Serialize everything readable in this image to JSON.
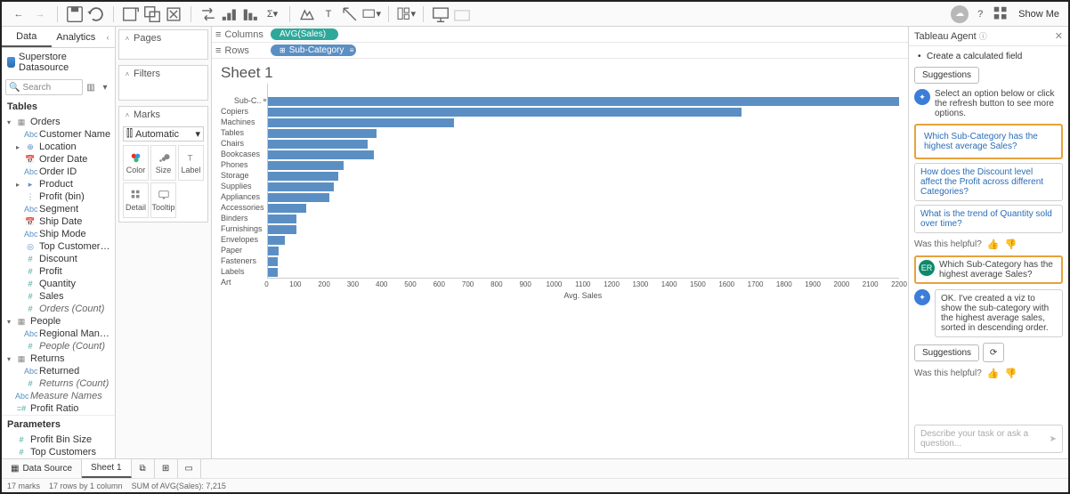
{
  "toolbar": {
    "show_me": "Show Me"
  },
  "tabs": {
    "data": "Data",
    "analytics": "Analytics"
  },
  "datasource": "Superstore Datasource",
  "search": {
    "placeholder": "Search"
  },
  "tables_header": "Tables",
  "parameters_header": "Parameters",
  "schema": {
    "orders": {
      "name": "Orders",
      "fields": [
        {
          "label": "Customer Name",
          "icon": "Abc",
          "cls": "dim-icon"
        },
        {
          "label": "Location",
          "icon": "⊕",
          "cls": "dim-icon",
          "caret": "▸"
        },
        {
          "label": "Order Date",
          "icon": "📅",
          "cls": "dim-icon"
        },
        {
          "label": "Order ID",
          "icon": "Abc",
          "cls": "dim-icon"
        },
        {
          "label": "Product",
          "icon": "▸",
          "cls": "dim-icon",
          "caret": "▸"
        },
        {
          "label": "Profit (bin)",
          "icon": "⋮",
          "cls": "dim-icon"
        },
        {
          "label": "Segment",
          "icon": "Abc",
          "cls": "dim-icon"
        },
        {
          "label": "Ship Date",
          "icon": "📅",
          "cls": "dim-icon"
        },
        {
          "label": "Ship Mode",
          "icon": "Abc",
          "cls": "dim-icon"
        },
        {
          "label": "Top Customers by P...",
          "icon": "◎",
          "cls": "dim-icon"
        },
        {
          "label": "Discount",
          "icon": "#",
          "cls": "meas-icon"
        },
        {
          "label": "Profit",
          "icon": "#",
          "cls": "meas-icon"
        },
        {
          "label": "Quantity",
          "icon": "#",
          "cls": "meas-icon"
        },
        {
          "label": "Sales",
          "icon": "#",
          "cls": "meas-icon"
        },
        {
          "label": "Orders (Count)",
          "icon": "#",
          "cls": "meas-icon",
          "italic": true
        }
      ]
    },
    "people": {
      "name": "People",
      "fields": [
        {
          "label": "Regional Manager",
          "icon": "Abc",
          "cls": "dim-icon"
        },
        {
          "label": "People (Count)",
          "icon": "#",
          "cls": "meas-icon",
          "italic": true
        }
      ]
    },
    "returns": {
      "name": "Returns",
      "fields": [
        {
          "label": "Returned",
          "icon": "Abc",
          "cls": "dim-icon"
        },
        {
          "label": "Returns (Count)",
          "icon": "#",
          "cls": "meas-icon",
          "italic": true
        }
      ]
    },
    "extra": [
      {
        "label": "Measure Names",
        "icon": "Abc",
        "cls": "dim-icon",
        "italic": true
      },
      {
        "label": "Profit Ratio",
        "icon": "=#",
        "cls": "meas-icon"
      }
    ],
    "params": [
      {
        "label": "Profit Bin Size",
        "icon": "#",
        "cls": "meas-icon"
      },
      {
        "label": "Top Customers",
        "icon": "#",
        "cls": "meas-icon"
      }
    ]
  },
  "shelves": {
    "pages": "Pages",
    "filters": "Filters",
    "marks": "Marks",
    "marktype": "Automatic",
    "cells": {
      "color": "Color",
      "size": "Size",
      "label": "Label",
      "detail": "Detail",
      "tooltip": "Tooltip"
    }
  },
  "ws": {
    "columns": "Columns",
    "rows": "Rows",
    "col_pill": "AVG(Sales)",
    "row_pill": "Sub-Category",
    "title": "Sheet 1",
    "y_header": "Sub-C..",
    "x_title": "Avg. Sales"
  },
  "chart_data": {
    "type": "bar",
    "orientation": "horizontal",
    "categories": [
      "Copiers",
      "Machines",
      "Tables",
      "Chairs",
      "Bookcases",
      "Phones",
      "Storage",
      "Supplies",
      "Appliances",
      "Accessories",
      "Binders",
      "Furnishings",
      "Envelopes",
      "Paper",
      "Fasteners",
      "Labels",
      "Art"
    ],
    "values": [
      2200,
      1650,
      650,
      380,
      350,
      370,
      265,
      245,
      230,
      215,
      135,
      100,
      100,
      60,
      40,
      35,
      35
    ],
    "xlabel": "Avg. Sales",
    "ylabel": "Sub-Category",
    "xlim": [
      0,
      2200
    ],
    "xticks": [
      0,
      100,
      200,
      300,
      400,
      500,
      600,
      700,
      800,
      900,
      1000,
      1100,
      1200,
      1300,
      1400,
      1500,
      1600,
      1700,
      1800,
      1900,
      2000,
      2100,
      2200
    ]
  },
  "agent": {
    "title": "Tableau Agent",
    "calc": "Create a calculated field",
    "suggestions": "Suggestions",
    "prompt": "Select an option below or click the refresh button to see more options.",
    "s1": "Which Sub-Category has the highest average Sales?",
    "s2": "How does the Discount level affect the Profit across different Categories?",
    "s3": "What is the trend of Quantity sold over time?",
    "helpful": "Was this helpful?",
    "user_msg": "Which Sub-Category has the highest average Sales?",
    "reply": "OK. I've created a viz to show the sub-category with the highest average sales, sorted in descending order.",
    "input_placeholder": "Describe your task or ask a question...",
    "user_badge": "ER"
  },
  "bottom": {
    "datasource": "Data Source",
    "sheet": "Sheet 1"
  },
  "status": {
    "marks": "17 marks",
    "rows": "17 rows by 1 column",
    "sum": "SUM of AVG(Sales): 7,215"
  }
}
